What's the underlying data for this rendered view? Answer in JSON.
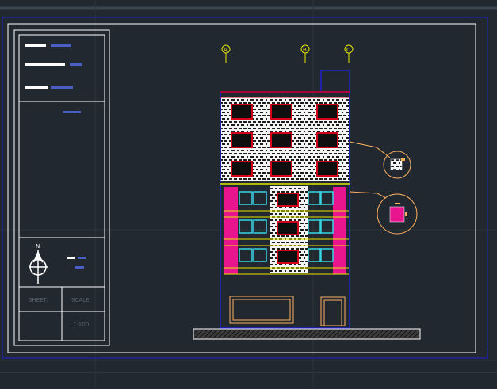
{
  "drawing": {
    "grid_labels": [
      "A",
      "B",
      "C"
    ],
    "title_block": {
      "sheet_label": "SHEET:",
      "scale_label": "SCALE:",
      "scale_value": "1:100",
      "north_label": "N"
    },
    "colors": {
      "background": "#212830",
      "white_line": "#ffffff",
      "blue_line": "#1f1fcf",
      "red_line": "#d4001a",
      "yellow_line": "#e6e600",
      "magenta_fill": "#e8158f",
      "cyan_line": "#38d5e6",
      "orange_line": "#ffb060",
      "grid_line": "#2e3640"
    }
  }
}
